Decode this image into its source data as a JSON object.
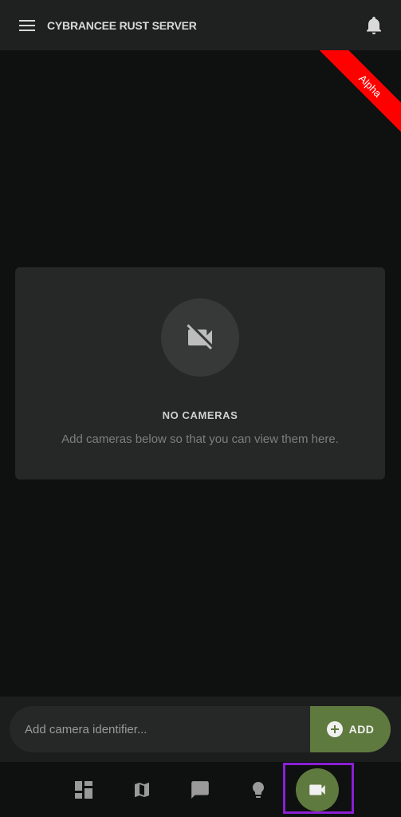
{
  "header": {
    "title": "CYBRANCEE RUST SERVER",
    "menu_icon": "hamburger-menu-icon",
    "notification_icon": "bell-icon"
  },
  "ribbon": {
    "label": "Alpha",
    "color": "#ff0000"
  },
  "empty_state": {
    "icon": "camera-off-icon",
    "title": "NO CAMERAS",
    "subtitle": "Add cameras below so that you can view them here."
  },
  "add_camera": {
    "placeholder": "Add camera identifier...",
    "value": "",
    "button_label": "ADD",
    "button_icon": "plus-circle-icon",
    "accent_color": "#5f7a3e"
  },
  "bottom_nav": {
    "items": [
      {
        "name": "dashboard",
        "icon": "dashboard-icon",
        "active": false
      },
      {
        "name": "map",
        "icon": "map-icon",
        "active": false
      },
      {
        "name": "chat",
        "icon": "chat-icon",
        "active": false
      },
      {
        "name": "smart-devices",
        "icon": "lightbulb-icon",
        "active": false
      },
      {
        "name": "cameras",
        "icon": "video-camera-icon",
        "active": true
      }
    ]
  },
  "colors": {
    "background": "#0f1010",
    "header": "#1f2020",
    "card": "#262727",
    "highlight_outline": "#8a1fd4"
  }
}
